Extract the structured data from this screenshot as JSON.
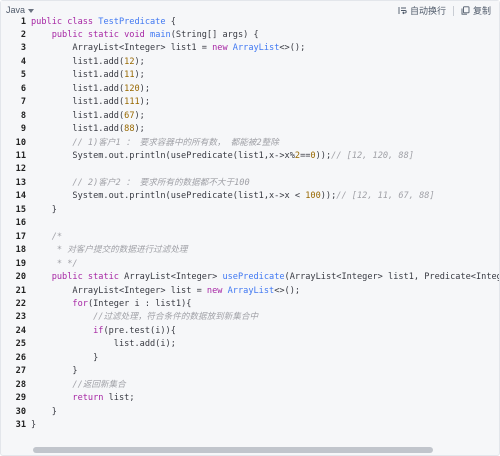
{
  "toolbar": {
    "language": "Java",
    "wrap_label": "自动换行",
    "copy_label": "复制"
  },
  "code": {
    "lines": [
      {
        "n": "1",
        "tokens": [
          {
            "t": "public class ",
            "c": "kw"
          },
          {
            "t": "TestPredicate",
            "c": "fn"
          },
          {
            "t": " {",
            "c": "plain"
          }
        ]
      },
      {
        "n": "2",
        "tokens": [
          {
            "t": "    ",
            "c": "plain"
          },
          {
            "t": "public static void ",
            "c": "kw"
          },
          {
            "t": "main",
            "c": "fn"
          },
          {
            "t": "(String[] args) {",
            "c": "plain"
          }
        ]
      },
      {
        "n": "3",
        "tokens": [
          {
            "t": "        ArrayList<Integer> list1 = ",
            "c": "plain"
          },
          {
            "t": "new ",
            "c": "kw"
          },
          {
            "t": "ArrayList",
            "c": "fn"
          },
          {
            "t": "<>();",
            "c": "plain"
          }
        ]
      },
      {
        "n": "4",
        "tokens": [
          {
            "t": "        list1.add(",
            "c": "plain"
          },
          {
            "t": "12",
            "c": "num"
          },
          {
            "t": ");",
            "c": "plain"
          }
        ]
      },
      {
        "n": "5",
        "tokens": [
          {
            "t": "        list1.add(",
            "c": "plain"
          },
          {
            "t": "11",
            "c": "num"
          },
          {
            "t": ");",
            "c": "plain"
          }
        ]
      },
      {
        "n": "6",
        "tokens": [
          {
            "t": "        list1.add(",
            "c": "plain"
          },
          {
            "t": "120",
            "c": "num"
          },
          {
            "t": ");",
            "c": "plain"
          }
        ]
      },
      {
        "n": "7",
        "tokens": [
          {
            "t": "        list1.add(",
            "c": "plain"
          },
          {
            "t": "111",
            "c": "num"
          },
          {
            "t": ");",
            "c": "plain"
          }
        ]
      },
      {
        "n": "8",
        "tokens": [
          {
            "t": "        list1.add(",
            "c": "plain"
          },
          {
            "t": "67",
            "c": "num"
          },
          {
            "t": ");",
            "c": "plain"
          }
        ]
      },
      {
        "n": "9",
        "tokens": [
          {
            "t": "        list1.add(",
            "c": "plain"
          },
          {
            "t": "88",
            "c": "num"
          },
          {
            "t": ");",
            "c": "plain"
          }
        ]
      },
      {
        "n": "10",
        "tokens": [
          {
            "t": "        ",
            "c": "plain"
          },
          {
            "t": "// 1)客户1 ： 要求容器中的所有数， 都能被2整除",
            "c": "cm"
          }
        ]
      },
      {
        "n": "11",
        "tokens": [
          {
            "t": "        System.out.println(usePredicate(list1,x->x%",
            "c": "plain"
          },
          {
            "t": "2",
            "c": "num"
          },
          {
            "t": "==",
            "c": "plain"
          },
          {
            "t": "0",
            "c": "num"
          },
          {
            "t": "));",
            "c": "plain"
          },
          {
            "t": "// [12, 120, 88]",
            "c": "cm"
          }
        ]
      },
      {
        "n": "12",
        "tokens": []
      },
      {
        "n": "13",
        "tokens": [
          {
            "t": "        ",
            "c": "plain"
          },
          {
            "t": "// 2)客户2 ： 要求所有的数据都不大于100",
            "c": "cm"
          }
        ]
      },
      {
        "n": "14",
        "tokens": [
          {
            "t": "        System.out.println(usePredicate(list1,x->x < ",
            "c": "plain"
          },
          {
            "t": "100",
            "c": "num"
          },
          {
            "t": "));",
            "c": "plain"
          },
          {
            "t": "// [12, 11, 67, 88]",
            "c": "cm"
          }
        ]
      },
      {
        "n": "15",
        "tokens": [
          {
            "t": "    }",
            "c": "plain"
          }
        ]
      },
      {
        "n": "16",
        "tokens": []
      },
      {
        "n": "17",
        "tokens": [
          {
            "t": "    /*",
            "c": "cm"
          }
        ]
      },
      {
        "n": "18",
        "tokens": [
          {
            "t": "     * 对客户提交的数据进行过滤处理",
            "c": "cm"
          }
        ]
      },
      {
        "n": "19",
        "tokens": [
          {
            "t": "     * */",
            "c": "cm"
          }
        ]
      },
      {
        "n": "20",
        "tokens": [
          {
            "t": "    ",
            "c": "plain"
          },
          {
            "t": "public static ",
            "c": "kw"
          },
          {
            "t": "ArrayList<Integer> ",
            "c": "plain"
          },
          {
            "t": "usePredicate",
            "c": "fn"
          },
          {
            "t": "(ArrayList<Integer> list1, Predicate<Integer",
            "c": "plain"
          }
        ]
      },
      {
        "n": "21",
        "tokens": [
          {
            "t": "        ArrayList<Integer> list = ",
            "c": "plain"
          },
          {
            "t": "new ",
            "c": "kw"
          },
          {
            "t": "ArrayList",
            "c": "fn"
          },
          {
            "t": "<>();",
            "c": "plain"
          }
        ]
      },
      {
        "n": "22",
        "tokens": [
          {
            "t": "        ",
            "c": "plain"
          },
          {
            "t": "for",
            "c": "kw"
          },
          {
            "t": "(Integer i : list1){",
            "c": "plain"
          }
        ]
      },
      {
        "n": "23",
        "tokens": [
          {
            "t": "            ",
            "c": "plain"
          },
          {
            "t": "//过滤处理，符合条件的数据放到新集合中",
            "c": "cm"
          }
        ]
      },
      {
        "n": "24",
        "tokens": [
          {
            "t": "            ",
            "c": "plain"
          },
          {
            "t": "if",
            "c": "kw"
          },
          {
            "t": "(pre.test(i)){",
            "c": "plain"
          }
        ]
      },
      {
        "n": "25",
        "tokens": [
          {
            "t": "                list.add(i);",
            "c": "plain"
          }
        ]
      },
      {
        "n": "26",
        "tokens": [
          {
            "t": "            }",
            "c": "plain"
          }
        ]
      },
      {
        "n": "27",
        "tokens": [
          {
            "t": "        }",
            "c": "plain"
          }
        ]
      },
      {
        "n": "28",
        "tokens": [
          {
            "t": "        ",
            "c": "plain"
          },
          {
            "t": "//返回新集合",
            "c": "cm"
          }
        ]
      },
      {
        "n": "29",
        "tokens": [
          {
            "t": "        ",
            "c": "plain"
          },
          {
            "t": "return ",
            "c": "kw"
          },
          {
            "t": "list;",
            "c": "plain"
          }
        ]
      },
      {
        "n": "30",
        "tokens": [
          {
            "t": "    }",
            "c": "plain"
          }
        ]
      },
      {
        "n": "31",
        "tokens": [
          {
            "t": "}",
            "c": "plain"
          }
        ]
      }
    ]
  },
  "colors": {
    "keyword": "#a626a4",
    "function": "#4078f2",
    "number": "#986801",
    "comment": "#a0a1a7",
    "plain": "#383a42",
    "background": "#f6f7f9"
  },
  "icons": {
    "wrap": "wrap-lines-icon",
    "copy": "copy-icon",
    "dropdown": "chevron-down-icon"
  }
}
